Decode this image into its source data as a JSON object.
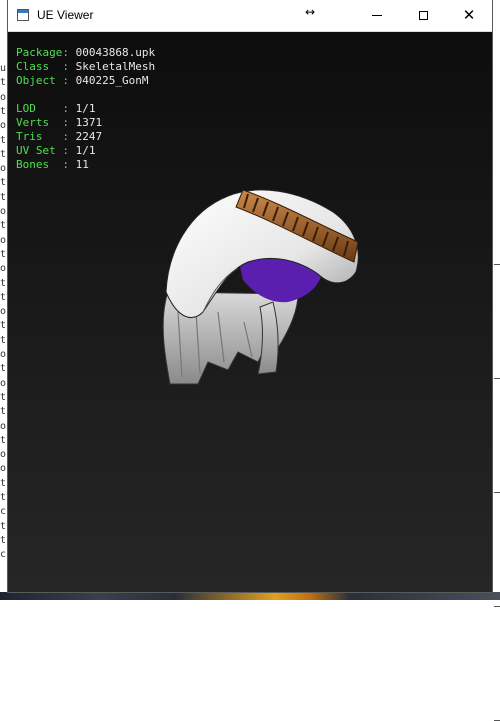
{
  "window": {
    "title": "UE Viewer"
  },
  "titlebar_controls": [
    "minimize",
    "maximize",
    "close"
  ],
  "info": {
    "package": {
      "label": "Package: ",
      "value": "00043868.upk"
    },
    "class": {
      "label": "Class  : ",
      "value": "SkeletalMesh"
    },
    "object": {
      "label": "Object : ",
      "value": "040225_GonM"
    },
    "lod": {
      "label": "LOD    : ",
      "value": "1/1"
    },
    "verts": {
      "label": "Verts  : ",
      "value": "1371"
    },
    "tris": {
      "label": "Tris   : ",
      "value": "2247"
    },
    "uvset": {
      "label": "UV Set : ",
      "value": "1/1"
    },
    "bones": {
      "label": "Bones  : ",
      "value": "11"
    }
  },
  "colors": {
    "label_green": "#4ee04e",
    "value_white": "#e8e8e8",
    "viewport_bg": "#1b1b1b",
    "cloth": "#e8e8e8",
    "rope": "#a0602a",
    "lining": "#5b1fb0"
  },
  "background_console": {
    "left_glyphs": [
      "u",
      "t",
      "o",
      "t",
      "o",
      "t",
      "t",
      "o",
      "t",
      "t",
      "o",
      "t",
      "o",
      "t",
      "o",
      "t",
      "t",
      "o",
      "t",
      "t",
      "o",
      "t",
      "o",
      "t",
      "t",
      "o",
      "t",
      "o",
      "o",
      "t",
      "t",
      "c",
      "t",
      "t",
      "c"
    ]
  }
}
